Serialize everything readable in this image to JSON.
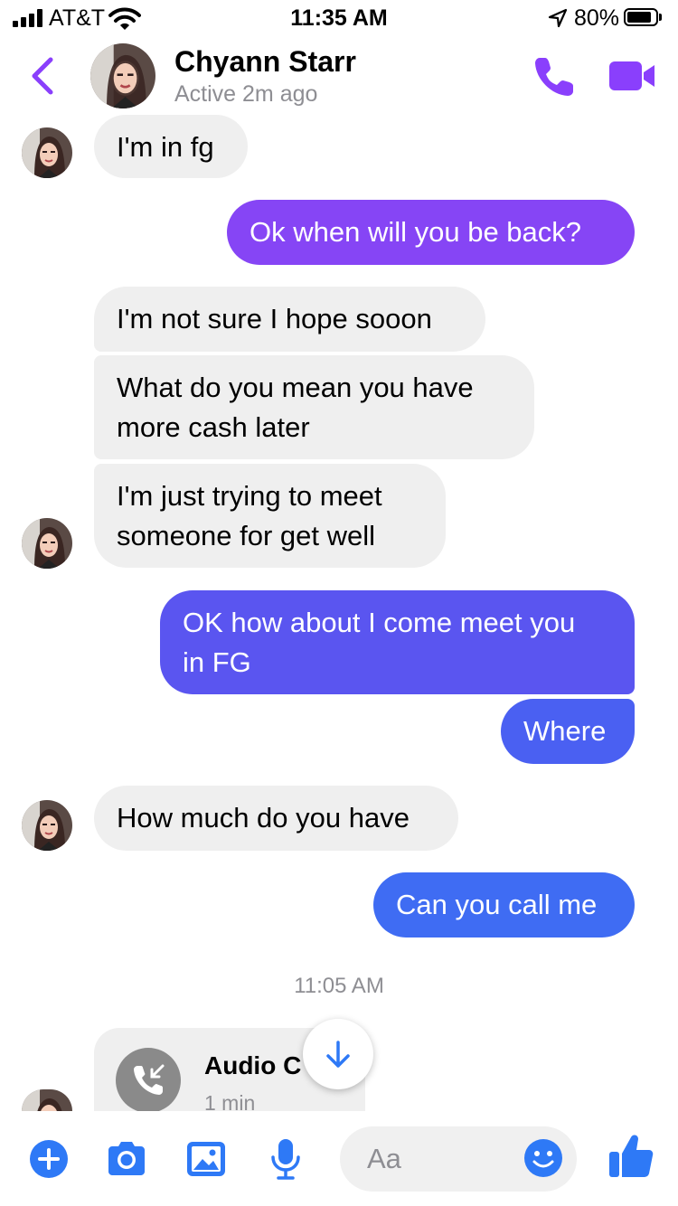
{
  "status_bar": {
    "carrier": "AT&T",
    "time": "11:35 AM",
    "battery": "80%"
  },
  "header": {
    "contact_name": "Chyann Starr",
    "contact_status": "Active 2m ago",
    "icons": [
      "back-chevron-icon",
      "phone-icon",
      "video-camera-icon"
    ]
  },
  "colors": {
    "accent": "#8a3ffc",
    "incoming_bubble": "#efefef",
    "outgoing_gradient": [
      "#8645f5",
      "#5a55f0",
      "#4a60f2",
      "#3f6cf3"
    ],
    "icon_blue": "#2e79f6"
  },
  "messages": [
    {
      "direction": "in",
      "text": "I'm in fg"
    },
    {
      "direction": "out",
      "text": "Ok when will you be back?"
    },
    {
      "direction": "in",
      "text": "I'm not sure I hope sooon"
    },
    {
      "direction": "in",
      "lines": [
        "What do you mean you have",
        "more cash later"
      ]
    },
    {
      "direction": "in",
      "lines": [
        "I'm just trying to meet",
        "someone for get well"
      ]
    },
    {
      "direction": "out",
      "lines": [
        "OK how about I come meet you",
        "in FG"
      ]
    },
    {
      "direction": "out",
      "text": "Where"
    },
    {
      "direction": "in",
      "text": "How much do you have"
    },
    {
      "direction": "out",
      "text": "Can you call me"
    }
  ],
  "timestamp": "11:05 AM",
  "call_card": {
    "title": "Audio C",
    "duration": "1 min"
  },
  "composer": {
    "placeholder": "Aa",
    "icons": [
      "plus-icon",
      "camera-icon",
      "photo-icon",
      "microphone-icon",
      "emoji-icon",
      "thumbs-up-icon"
    ]
  }
}
